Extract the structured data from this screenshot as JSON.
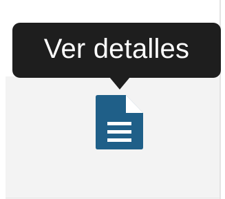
{
  "tooltip": {
    "text": "Ver detalles"
  },
  "action": {
    "icon": "document-details-icon",
    "icon_color": "#1f5f88"
  },
  "colors": {
    "tooltip_background": "#1e1e1e",
    "cell_background": "#f3f3f3"
  }
}
